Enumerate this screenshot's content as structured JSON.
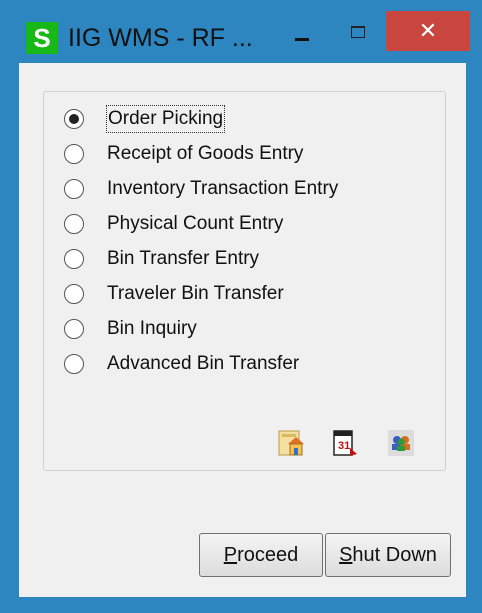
{
  "window": {
    "app_icon_letter": "S",
    "title": "IIG WMS - RF ...",
    "close_glyph": "✕"
  },
  "options": [
    {
      "label": "Order Picking",
      "checked": true
    },
    {
      "label": "Receipt of Goods Entry",
      "checked": false
    },
    {
      "label": "Inventory Transaction Entry",
      "checked": false
    },
    {
      "label": "Physical Count Entry",
      "checked": false
    },
    {
      "label": "Bin Transfer Entry",
      "checked": false
    },
    {
      "label": "Traveler Bin Transfer",
      "checked": false
    },
    {
      "label": "Bin Inquiry",
      "checked": false
    },
    {
      "label": "Advanced Bin Transfer",
      "checked": false
    }
  ],
  "toolbar_icons": [
    "company-home-icon",
    "calendar-report-icon",
    "users-icon"
  ],
  "buttons": {
    "proceed": {
      "accel": "P",
      "rest": "roceed"
    },
    "shutdown": {
      "accel": "S",
      "rest": "hut Down"
    }
  },
  "colors": {
    "frame": "#2e86c1",
    "close_button": "#c9463f",
    "app_icon": "#18b818"
  }
}
